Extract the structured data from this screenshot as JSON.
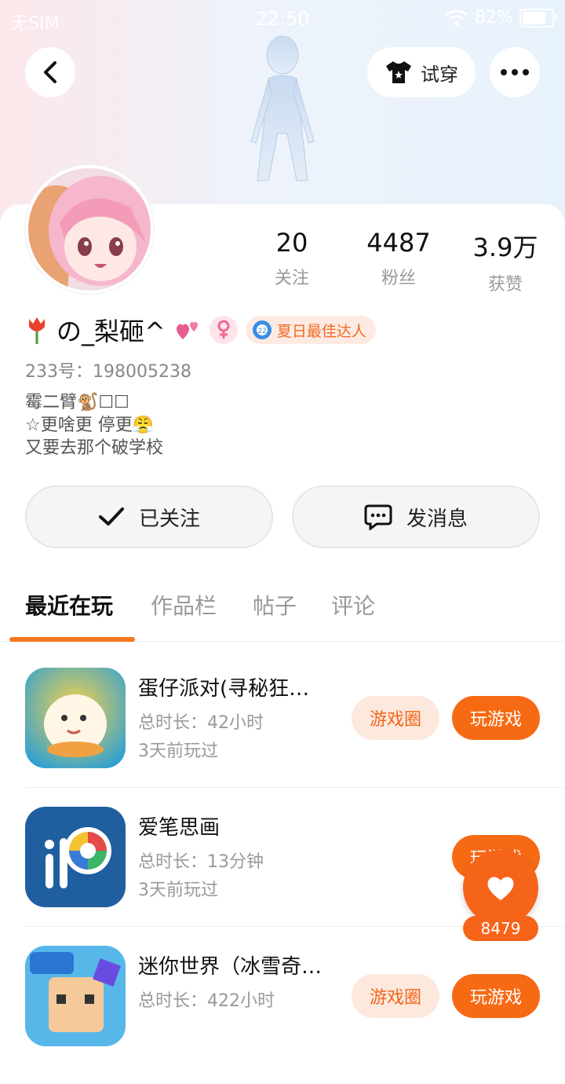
{
  "status_bar": {
    "sim": "无SIM",
    "time": "22:50",
    "battery": "82%",
    "battery_level": 0.82
  },
  "top_bar": {
    "try_on_label": "试穿"
  },
  "profile": {
    "stats": [
      {
        "value": "20",
        "label": "关注"
      },
      {
        "value": "4487",
        "label": "粉丝"
      },
      {
        "value": "3.9万",
        "label": "获赞"
      }
    ],
    "name": "の_梨砸^",
    "badge": "夏日最佳达人",
    "uid": "233号：198005238",
    "bio": [
      "霉二臂🐒☐☐",
      "☆更啥更 停更😤",
      "又要去那个破学校"
    ]
  },
  "actions": {
    "follow": "已关注",
    "message": "发消息"
  },
  "tabs": [
    "最近在玩",
    "作品栏",
    "帖子",
    "评论"
  ],
  "games": [
    {
      "title": "蛋仔派对(寻秘狂…",
      "duration": "总时长：42小时",
      "last_played": "3天前玩过",
      "circle_label": "游戏圈",
      "play_label": "玩游戏"
    },
    {
      "title": "爱笔思画",
      "duration": "总时长：13分钟",
      "last_played": "3天前玩过",
      "circle_label": "",
      "play_label": "玩游戏"
    },
    {
      "title": "迷你世界（冰雪奇…",
      "duration": "总时长：422小时",
      "last_played": "",
      "circle_label": "游戏圈",
      "play_label": "玩游戏"
    }
  ],
  "like_count": "8479",
  "colors": {
    "accent": "#f66a14",
    "badge_text": "#f06a25"
  }
}
